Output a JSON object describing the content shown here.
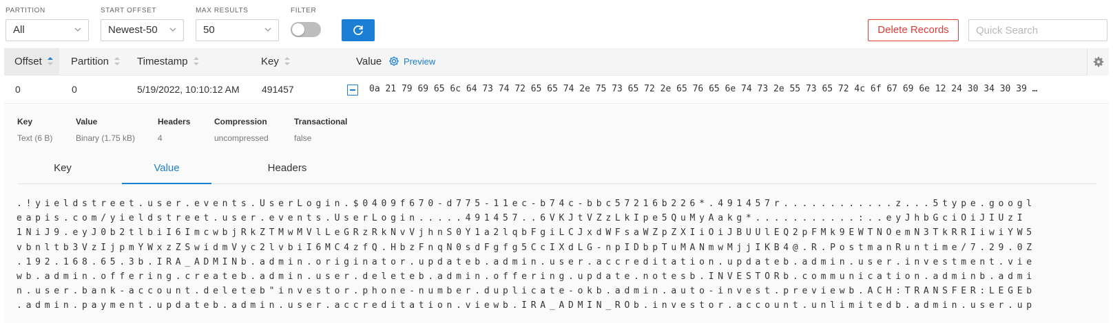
{
  "filters": {
    "partition": {
      "label": "PARTITION",
      "value": "All"
    },
    "start_offset": {
      "label": "START OFFSET",
      "value": "Newest-50"
    },
    "max_results": {
      "label": "MAX RESULTS",
      "value": "50"
    },
    "filter": {
      "label": "FILTER",
      "enabled": false
    }
  },
  "toolbar": {
    "refresh_icon": "refresh-icon",
    "delete_label": "Delete Records",
    "search_placeholder": "Quick Search"
  },
  "table": {
    "columns": {
      "offset": "Offset",
      "partition": "Partition",
      "timestamp": "Timestamp",
      "key": "Key",
      "value": "Value",
      "preview": "Preview"
    },
    "sort_column": "Offset",
    "rows": [
      {
        "offset": "0",
        "partition": "0",
        "timestamp": "5/19/2022, 10:10:12 AM",
        "key": "491457",
        "value_hex": "0a 21 79 69 65 6c 64 73 74 72 65 65 74 2e 75 73 65 72 2e 65 76 65 6e 74 73 2e 55 73 65 72 4c 6f 67 69 6e 12 24 30 34 30 39 …"
      }
    ]
  },
  "details": {
    "key": {
      "label": "Key",
      "value": "Text (6 B)"
    },
    "value": {
      "label": "Value",
      "value": "Binary (1.75 kB)"
    },
    "headers": {
      "label": "Headers",
      "value": "4"
    },
    "compression": {
      "label": "Compression",
      "value": "uncompressed"
    },
    "transactional": {
      "label": "Transactional",
      "value": "false"
    }
  },
  "tabs": {
    "key": "Key",
    "value": "Value",
    "headers": "Headers",
    "active": "Value"
  },
  "decoded_value": {
    "lines": [
      ".!yieldstreet.user.events.UserLogin.$0409f670-d775-11ec-b74c-bbc57216b226*.491457r............z...5type.googl",
      "eapis.com/yieldstreet.user.events.UserLogin.....491457..6VKJtVZzLkIpe5QuMyAakg*...........:..eyJhbGciOiJIUzI",
      "1NiJ9.eyJ0b2tlbiI6ImcwbjRkZTMwMVlLeGRzRkNvVjhnS0Y1a2lqbFgiLCJxdWFsaWZpZXIiOiJBUUlEQ2pFMk9EWTNOemN3TkRRIiwiYW5",
      "vbnltb3VzIjpmYWxzZSwidmVyc2lvbiI6MC4zfQ.HbzFnqN0sdFgfg5CcIXdLG-npIDbpTuMANmwMjjIKB4@.R.PostmanRuntime/7.29.0Z",
      ".192.168.65.3b.IRA_ADMINb.admin.originator.updateb.admin.user.accreditation.updateb.admin.user.investment.vie",
      "wb.admin.offering.createb.admin.user.deleteb.admin.offering.update.notesb.INVESTORb.communication.adminb.admi",
      "n.user.bank-account.deleteb\"investor.phone-number.duplicate-okb.admin.auto-invest.previewb.ACH:TRANSFER:LEGEb",
      ".admin.payment.updateb.admin.user.accreditation.viewb.IRA_ADMIN_ROb.investor.account.unlimitedb.admin.user.up"
    ]
  },
  "colors": {
    "accent": "#1b7fd6",
    "danger": "#e53935",
    "header_bg": "#f5f5f5",
    "expanded_bg": "#fafafa"
  }
}
